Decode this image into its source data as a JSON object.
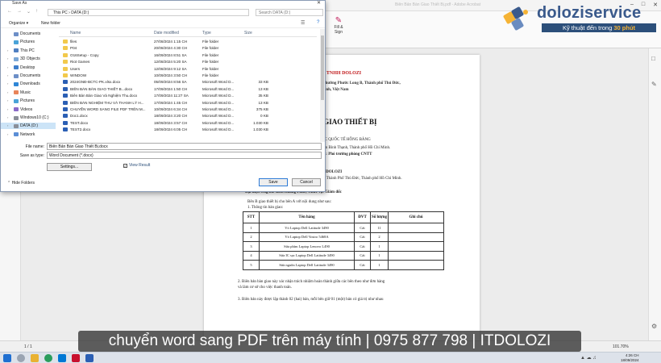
{
  "acrobat": {
    "title": "Biên Bản Bàn Giao Thiết Bị.pdf - Adobe Acrobat",
    "fill_sign_label": "Fill & Sign",
    "page_indicator": "1 / 1",
    "zoom": "101.70%"
  },
  "logo": {
    "brand": "doloziservice",
    "tagline_prefix": "Kỹ thuật đến trong ",
    "tagline_highlight": "30 phút"
  },
  "document": {
    "company": "NG TY TNHH DOLOZI",
    "address_line1": "12, Phường Phước Long B, Thành phố Thủ Đức,",
    "address_line2": "inh, Việt Nam",
    "title": "ÀN GIAO THIẾT BỊ",
    "party_a_1": "ỌC QUỐC TẾ HỒNG BÀNG",
    "party_a_2": "uận Bình Thạnh, Thành phố Hồ Chí Minh.",
    "party_a_3": "vụ: Phó trưởng phòng CNTT",
    "party_b_name": "H DOLOZI",
    "party_b_addr": "B, Thành Phố Thủ Đức, Thành phố Hồ Chí Minh.",
    "party_b_rep": "Đại diện Ông/bà: Biên Hoàng Phúc; Chức vụ: Giám đốc",
    "intro": "Bên B giao thiết bị cho bên A với nội dung như sau:",
    "section1": "1. Thông tin bàn giao:",
    "table_headers": [
      "STT",
      "Tên hàng",
      "ĐVT",
      "Số lượng",
      "Ghi chú"
    ],
    "table_rows": [
      [
        "1",
        "Vỏ Laptop Dell Latitude 3490",
        "Cái",
        "11",
        ""
      ],
      [
        "2",
        "Vỏ Laptop Dell Vostro 5468A",
        "Cái",
        "2",
        ""
      ],
      [
        "3",
        "Sửa phím Laptop Lenovo L490",
        "Cái",
        "1",
        ""
      ],
      [
        "4",
        "Sửa IC sạc Laptop Dell Latitude 3490",
        "Cái",
        "1",
        ""
      ],
      [
        "5",
        "Sửa nguồn Laptop Dell Latitude 3490",
        "Cái",
        "1",
        ""
      ]
    ],
    "section2_l1": "2. Biên bản bàn giao này xác nhận trách nhiệm hoàn thành giữa các bên theo như đơn hàng",
    "section2_l2": "và làm cơ sở cho việc thanh toán.",
    "section3": "3. Biên bản này được lập thành 02 (hai) bản, mỗi bên giữ 01 (một) bản có giá trị như nhau"
  },
  "dialog": {
    "title": "Save As",
    "breadcrumb": "This PC  ›  DATA (D:)",
    "search_placeholder": "Search DATA (D:)",
    "organize": "Organize ▾",
    "new_folder": "New folder",
    "nav_items": [
      {
        "label": "Documents",
        "kind": "docs"
      },
      {
        "label": "Pictures",
        "kind": "pics"
      },
      {
        "label": "This PC",
        "kind": "pc"
      },
      {
        "label": "3D Objects",
        "kind": "obj"
      },
      {
        "label": "Desktop",
        "kind": "desk"
      },
      {
        "label": "Documents",
        "kind": "docs"
      },
      {
        "label": "Downloads",
        "kind": "down"
      },
      {
        "label": "Music",
        "kind": "music"
      },
      {
        "label": "Pictures",
        "kind": "pics"
      },
      {
        "label": "Videos",
        "kind": "vid"
      },
      {
        "label": "Windows10 (C:)",
        "kind": "drive"
      },
      {
        "label": "DATA (D:)",
        "kind": "drive"
      },
      {
        "label": "Network",
        "kind": "net"
      }
    ],
    "columns": [
      "Name",
      "Date modified",
      "Type",
      "Size"
    ],
    "files": [
      {
        "name": "files",
        "date": "27/08/2024 1:15 CH",
        "type": "File folder",
        "size": "",
        "kind": "folder"
      },
      {
        "name": "P04",
        "date": "20/08/2024 4:30 CH",
        "type": "File folder",
        "size": "",
        "kind": "folder"
      },
      {
        "name": "O16Setup - Copy",
        "date": "16/09/2024 8:51 SA",
        "type": "File folder",
        "size": "",
        "kind": "folder"
      },
      {
        "name": "Riot Games",
        "date": "12/08/2024 5:20 SA",
        "type": "File folder",
        "size": "",
        "kind": "folder"
      },
      {
        "name": "Users",
        "date": "12/08/2024 9:12 SA",
        "type": "File folder",
        "size": "",
        "kind": "folder"
      },
      {
        "name": "WINDOW",
        "date": "10/09/2024 3:50 CH",
        "type": "File folder",
        "size": "",
        "kind": "folder"
      },
      {
        "name": "2024GNĐ-BCTC-PK.xlsx.docx",
        "date": "05/09/2024 8:56 SA",
        "type": "Microsoft Word D...",
        "size": "33 KB",
        "kind": "docx"
      },
      {
        "name": "BIÊN BẢN BÀN GIAO THIẾT B...docx",
        "date": "17/09/2024 1:50 CH",
        "type": "Microsoft Word D...",
        "size": "13 KB",
        "kind": "docx"
      },
      {
        "name": "Biên Bản Bàn Giao Và Nghiệm Thu.docx",
        "date": "17/09/2024 11:27 SA",
        "type": "Microsoft Word D...",
        "size": "35 KB",
        "kind": "docx"
      },
      {
        "name": "BIÊN BẢN NGHIỆM THU VÀ THANH LÝ H...",
        "date": "17/09/2024 1:45 CH",
        "type": "Microsoft Word D...",
        "size": "13 KB",
        "kind": "docx"
      },
      {
        "name": "CHUYỂN WORD SANG FILE PDF TRÊN M...",
        "date": "10/09/2024 6:34 CH",
        "type": "Microsoft Word D...",
        "size": "375 KB",
        "kind": "docx"
      },
      {
        "name": "Doc1.docx",
        "date": "18/09/2024 3:20 CH",
        "type": "Microsoft Word D...",
        "size": "0 KB",
        "kind": "docx"
      },
      {
        "name": "TEST.docx",
        "date": "18/09/2024 3:57 CH",
        "type": "Microsoft Word D...",
        "size": "1.030 KB",
        "kind": "docx"
      },
      {
        "name": "TEST2.docx",
        "date": "18/09/2024 6:05 CH",
        "type": "Microsoft Word D...",
        "size": "1.030 KB",
        "kind": "docx"
      }
    ],
    "file_name_label": "File name:",
    "file_name_value": "Biên Bản Bàn Giao Thiết Bị.docx",
    "save_type_label": "Save as type:",
    "save_type_value": "Word Document (*.docx)",
    "settings_label": "Settings...",
    "view_result_label": "View Result",
    "save_label": "Save",
    "cancel_label": "Cancel",
    "hide_folders_label": "Hide Folders"
  },
  "taskbar": {
    "time": "4:26 CH",
    "date": "18/09/2024"
  },
  "caption": "chuyển word sang PDF trên máy tính | 0975 877 798 | ITDOLOZI",
  "colors": {
    "doc_red": "#c0181a",
    "brand_blue": "#2c4f7a",
    "accent_yellow": "#f5b335",
    "selection": "#cce4f7"
  }
}
